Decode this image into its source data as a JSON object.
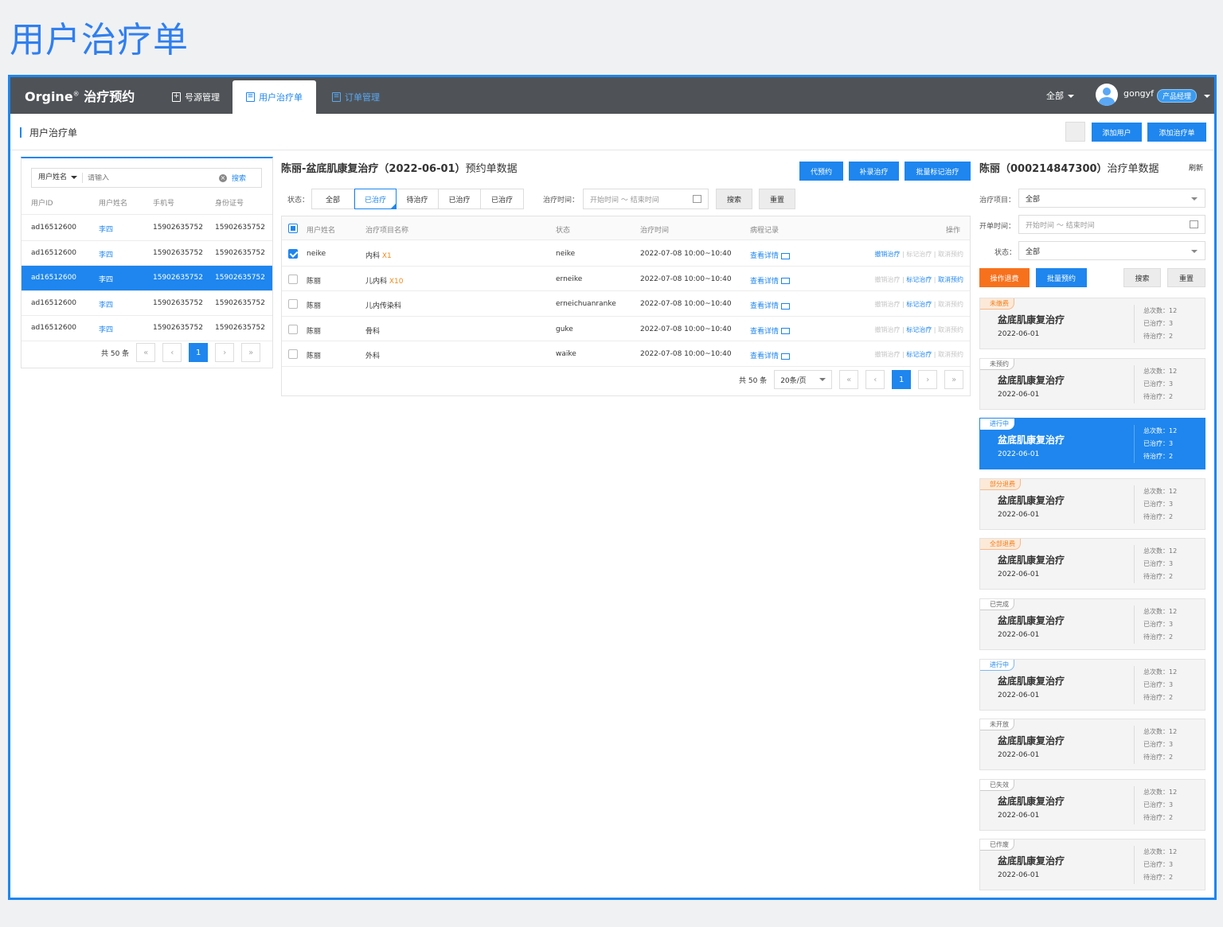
{
  "doc_title": "用户治疗单",
  "topbar": {
    "logo": "Orgine",
    "logo_reg": "®",
    "app_name": "治疗预约",
    "tabs": [
      {
        "label": "号源管理",
        "state": "normal"
      },
      {
        "label": "用户治疗单",
        "state": "active"
      },
      {
        "label": "订单管理",
        "state": "disabled"
      }
    ],
    "scope": "全部",
    "username": "gongyf",
    "role": "产品经理"
  },
  "subbar": {
    "title": "用户治疗单",
    "add_user": "添加用户",
    "add_order": "添加治疗单"
  },
  "left": {
    "search_field": "用户姓名",
    "search_placeholder": "请输入",
    "search_btn": "搜索",
    "columns": [
      "用户ID",
      "用户姓名",
      "手机号",
      "身份证号"
    ],
    "rows": [
      {
        "id": "ad16512600",
        "name": "李四",
        "phone": "15902635752",
        "idno": "15902635752",
        "selected": false
      },
      {
        "id": "ad16512600",
        "name": "李四",
        "phone": "15902635752",
        "idno": "15902635752",
        "selected": false
      },
      {
        "id": "ad16512600",
        "name": "李四",
        "phone": "15902635752",
        "idno": "15902635752",
        "selected": true
      },
      {
        "id": "ad16512600",
        "name": "李四",
        "phone": "15902635752",
        "idno": "15902635752",
        "selected": false
      },
      {
        "id": "ad16512600",
        "name": "李四",
        "phone": "15902635752",
        "idno": "15902635752",
        "selected": false
      }
    ],
    "total": "共 50 条",
    "page": "1"
  },
  "middle": {
    "title": "陈丽-盆底肌康复治疗（2022-06-01）",
    "title_suffix": "预约单数据",
    "btn_proxy": "代预约",
    "btn_record": "补录治疗",
    "btn_batch": "批量标记治疗",
    "status_label": "状态：",
    "status_tabs": [
      "全部",
      "已治疗",
      "待治疗",
      "已治疗",
      "已治疗"
    ],
    "time_label": "治疗时间：",
    "date_placeholder": "开始时间  ～  结束时间",
    "search": "搜索",
    "reset": "重置",
    "columns": [
      "用户姓名",
      "治疗项目名称",
      "状态",
      "治疗时间",
      "病程记录",
      "操作"
    ],
    "rows": [
      {
        "checked": true,
        "name": "neike",
        "item": "内科",
        "mult": "X1",
        "status": "neike",
        "time": "2022-07-08 10:00~10:40",
        "record": "查看详情",
        "op1": "撤销治疗",
        "op2": "标记治疗",
        "op3": "取消预约",
        "active": [
          true,
          false,
          false
        ]
      },
      {
        "checked": false,
        "name": "陈丽",
        "item": "儿内科",
        "mult": "X10",
        "status": "erneike",
        "time": "2022-07-08 10:00~10:40",
        "record": "查看详情",
        "op1": "撤销治疗",
        "op2": "标记治疗",
        "op3": "取消预约",
        "active": [
          false,
          true,
          true
        ]
      },
      {
        "checked": false,
        "name": "陈丽",
        "item": "儿内传染科",
        "mult": "",
        "status": "erneichuanranke",
        "time": "2022-07-08 10:00~10:40",
        "record": "查看详情",
        "op1": "撤销治疗",
        "op2": "标记治疗",
        "op3": "取消预约",
        "active": [
          false,
          true,
          false
        ]
      },
      {
        "checked": false,
        "name": "陈丽",
        "item": "骨科",
        "mult": "",
        "status": "guke",
        "time": "2022-07-08 10:00~10:40",
        "record": "查看详情",
        "op1": "撤销治疗",
        "op2": "标记治疗",
        "op3": "取消预约",
        "active": [
          false,
          true,
          false
        ]
      },
      {
        "checked": false,
        "name": "陈丽",
        "item": "外科",
        "mult": "",
        "status": "waike",
        "time": "2022-07-08 10:00~10:40",
        "record": "查看详情",
        "op1": "撤销治疗",
        "op2": "标记治疗",
        "op3": "取消预约",
        "active": [
          false,
          true,
          false
        ]
      }
    ],
    "total": "共 50 条",
    "page_size": "20条/页",
    "page": "1"
  },
  "right": {
    "title": "陈丽（000214847300）",
    "title_suffix": "治疗单数据",
    "refresh": "刷新",
    "item_label": "治疗项目：",
    "item_value": "全部",
    "date_label": "开单时间：",
    "date_placeholder": "开始时间  ～  结束时间",
    "status_label": "状态：",
    "status_value": "全部",
    "btn_refund": "操作退费",
    "btn_batch": "批量预约",
    "search": "搜索",
    "reset": "重置",
    "cards": [
      {
        "tag": "未缴费",
        "tag_style": "orange",
        "name": "盆底肌康复治疗",
        "date": "2022-06-01",
        "total": "总次数：12",
        "done": "已治疗：3",
        "todo": "待治疗：2",
        "active": false
      },
      {
        "tag": "未预约",
        "tag_style": "gray",
        "name": "盆底肌康复治疗",
        "date": "2022-06-01",
        "total": "总次数：12",
        "done": "已治疗：3",
        "todo": "待治疗：2",
        "active": false
      },
      {
        "tag": "进行中",
        "tag_style": "hi",
        "name": "盆底肌康复治疗",
        "date": "2022-06-01",
        "total": "总次数：12",
        "done": "已治疗：3",
        "todo": "待治疗：2",
        "active": true
      },
      {
        "tag": "部分退费",
        "tag_style": "orange",
        "name": "盆底肌康复治疗",
        "date": "2022-06-01",
        "total": "总次数：12",
        "done": "已治疗：3",
        "todo": "待治疗：2",
        "active": false
      },
      {
        "tag": "全部退费",
        "tag_style": "orange",
        "name": "盆底肌康复治疗",
        "date": "2022-06-01",
        "total": "总次数：12",
        "done": "已治疗：3",
        "todo": "待治疗：2",
        "active": false
      },
      {
        "tag": "已完成",
        "tag_style": "gray",
        "name": "盆底肌康复治疗",
        "date": "2022-06-01",
        "total": "总次数：12",
        "done": "已治疗：3",
        "todo": "待治疗：2",
        "active": false
      },
      {
        "tag": "进行中",
        "tag_style": "blue",
        "name": "盆底肌康复治疗",
        "date": "2022-06-01",
        "total": "总次数：12",
        "done": "已治疗：3",
        "todo": "待治疗：2",
        "active": false
      },
      {
        "tag": "未开放",
        "tag_style": "gray",
        "name": "盆底肌康复治疗",
        "date": "2022-06-01",
        "total": "总次数：12",
        "done": "已治疗：3",
        "todo": "待治疗：2",
        "active": false
      },
      {
        "tag": "已失效",
        "tag_style": "gray",
        "name": "盆底肌康复治疗",
        "date": "2022-06-01",
        "total": "总次数：12",
        "done": "已治疗：3",
        "todo": "待治疗：2",
        "active": false
      },
      {
        "tag": "已作废",
        "tag_style": "gray",
        "name": "盆底肌康复治疗",
        "date": "2022-06-01",
        "total": "总次数：12",
        "done": "已治疗：3",
        "todo": "待治疗：2",
        "active": false
      }
    ]
  },
  "colors": {
    "accent": "#1e86ee",
    "topbar": "#4f5357",
    "orange": "#f7711d",
    "doc_title": "#2f7ff0"
  }
}
